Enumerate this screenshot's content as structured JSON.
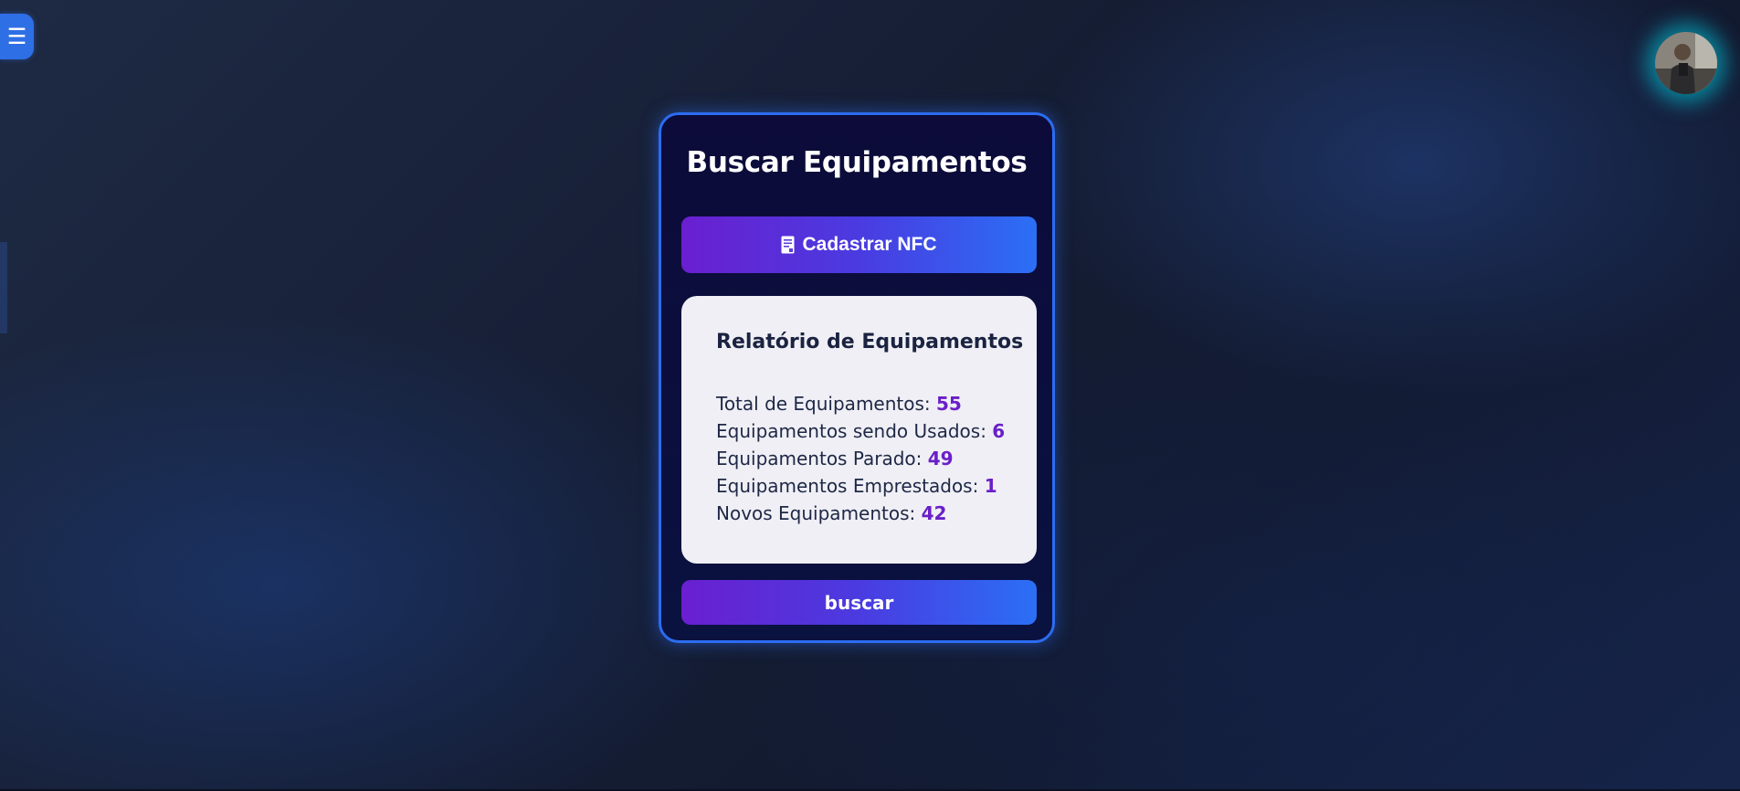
{
  "sidebar": {
    "toggle_icon": "☰"
  },
  "user": {
    "avatar_icon": "user-avatar-photo"
  },
  "card": {
    "title": "Buscar Equipamentos",
    "nfc_button_label": "Cadastrar NFC",
    "nfc_button_icon": "document-icon",
    "report": {
      "title": "Relatório de Equipamentos",
      "stats": [
        {
          "label": "Total de Equipamentos: ",
          "value": "55"
        },
        {
          "label": "Equipamentos sendo Usados: ",
          "value": "6"
        },
        {
          "label": "Equipamentos Parado: ",
          "value": "49"
        },
        {
          "label": "Equipamentos Emprestados: ",
          "value": "1"
        },
        {
          "label": "Novos Equipamentos: ",
          "value": "42"
        }
      ]
    },
    "search_button_label": "buscar"
  },
  "colors": {
    "accent_blue": "#2c6cf0",
    "accent_purple": "#6a1fd0",
    "value_purple": "#6a1fc8",
    "avatar_glow": "#00d2e6"
  }
}
